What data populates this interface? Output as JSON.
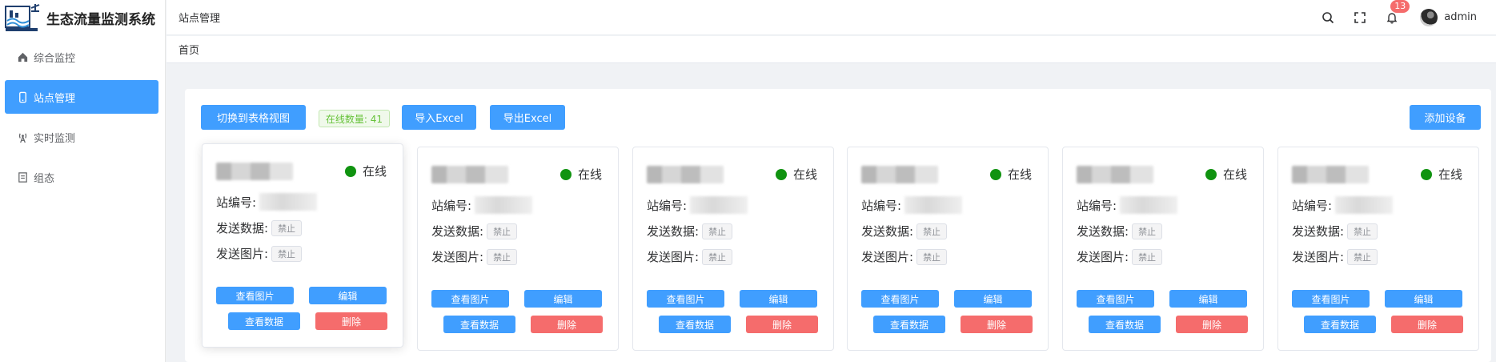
{
  "app": {
    "title": "生态流量监测系统"
  },
  "header": {
    "page_title": "站点管理",
    "notification_count": "13",
    "username": "admin"
  },
  "breadcrumb": {
    "home": "首页"
  },
  "sidebar": {
    "items": [
      {
        "label": "综合监控",
        "icon": "home-icon",
        "active": false
      },
      {
        "label": "站点管理",
        "icon": "mobile-device-icon",
        "active": true
      },
      {
        "label": "实时监测",
        "icon": "signal-tower-icon",
        "active": false
      },
      {
        "label": "组态",
        "icon": "document-icon",
        "active": false
      }
    ]
  },
  "toolbar": {
    "switch_view_label": "切换到表格视图",
    "online_count_label": "在线数量: 41",
    "import_label": "导入Excel",
    "export_label": "导出Excel",
    "add_device_label": "添加设备"
  },
  "card_labels": {
    "station_id": "站编号:",
    "send_data": "发送数据:",
    "send_picture": "发送图片:",
    "view_picture": "查看图片",
    "edit": "编辑",
    "view_data": "查看数据",
    "delete": "删除"
  },
  "stations": [
    {
      "status": "在线",
      "send_data": "禁止",
      "send_picture": "禁止"
    },
    {
      "status": "在线",
      "send_data": "禁止",
      "send_picture": "禁止"
    },
    {
      "status": "在线",
      "send_data": "禁止",
      "send_picture": "禁止"
    },
    {
      "status": "在线",
      "send_data": "禁止",
      "send_picture": "禁止"
    },
    {
      "status": "在线",
      "send_data": "禁止",
      "send_picture": "禁止"
    },
    {
      "status": "在线",
      "send_data": "禁止",
      "send_picture": "禁止"
    }
  ],
  "colors": {
    "primary": "#409eff",
    "danger": "#f56c6c",
    "online_dot": "#109310",
    "success_text": "#67c23a"
  }
}
